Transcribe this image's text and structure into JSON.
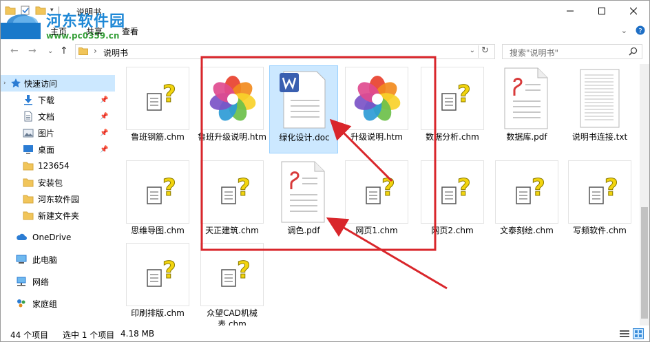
{
  "window": {
    "title": "说明书",
    "watermark_title": "河东软件园",
    "watermark_url": "www.pc0359.cn"
  },
  "ribbon": {
    "tabs": [
      "主页",
      "共享",
      "查看"
    ]
  },
  "address": {
    "path": "说明书",
    "search_placeholder": "搜索\"说明书\""
  },
  "sidebar": {
    "quick_access": "快速访问",
    "items": [
      {
        "label": "下载",
        "icon": "download-arrow-icon",
        "pinned": true
      },
      {
        "label": "文档",
        "icon": "document-icon",
        "pinned": true
      },
      {
        "label": "图片",
        "icon": "picture-icon",
        "pinned": true
      },
      {
        "label": "桌面",
        "icon": "desktop-icon",
        "pinned": true
      },
      {
        "label": "123654",
        "icon": "folder-icon",
        "pinned": false
      },
      {
        "label": "安装包",
        "icon": "folder-icon",
        "pinned": false
      },
      {
        "label": "河东软件园",
        "icon": "folder-icon",
        "pinned": false
      },
      {
        "label": "新建文件夹",
        "icon": "folder-icon",
        "pinned": false
      }
    ],
    "onedrive": "OneDrive",
    "this_pc": "此电脑",
    "network": "网络",
    "homegroup": "家庭组"
  },
  "files": [
    {
      "name": "鲁班钢筋.chm",
      "type": "chm"
    },
    {
      "name": "鲁班升级说明.htm",
      "type": "htm"
    },
    {
      "name": "绿化设计.doc",
      "type": "doc",
      "selected": true
    },
    {
      "name": "升级说明.htm",
      "type": "htm"
    },
    {
      "name": "数据分析.chm",
      "type": "chm"
    },
    {
      "name": "数据库.pdf",
      "type": "pdf"
    },
    {
      "name": "说明书连接.txt",
      "type": "txt"
    },
    {
      "name": "思维导图.chm",
      "type": "chm"
    },
    {
      "name": "天正建筑.chm",
      "type": "chm"
    },
    {
      "name": "调色.pdf",
      "type": "pdf"
    },
    {
      "name": "网页1.chm",
      "type": "chm"
    },
    {
      "name": "网页2.chm",
      "type": "chm"
    },
    {
      "name": "文泰刻绘.chm",
      "type": "chm"
    },
    {
      "name": "写频软件.chm",
      "type": "chm"
    },
    {
      "name": "印刷排版.chm",
      "type": "chm"
    },
    {
      "name": "众望CAD机械表.chm",
      "type": "chm"
    }
  ],
  "status": {
    "count": "44 个项目",
    "selected": "选中 1 个项目",
    "size": "4.18 MB"
  },
  "colors": {
    "accent": "#1979ca",
    "selection": "#cce8ff",
    "highlight_red": "#d9262b",
    "arrow_red": "#d9262b"
  }
}
